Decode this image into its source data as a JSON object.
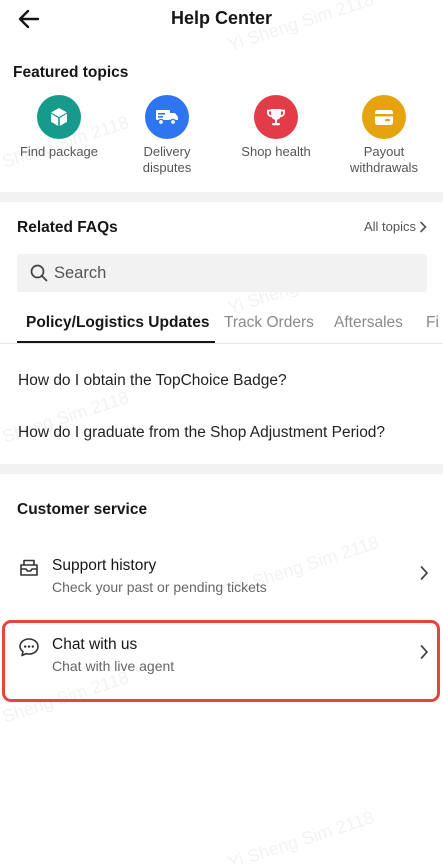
{
  "header": {
    "title": "Help Center",
    "back_icon": "arrow-left-icon"
  },
  "featured": {
    "title": "Featured topics",
    "items": [
      {
        "label": "Find package",
        "icon": "box-icon",
        "color": "#159a8b"
      },
      {
        "label": "Delivery\ndisputes",
        "icon": "truck-icon",
        "color": "#2f74f0"
      },
      {
        "label": "Shop health",
        "icon": "trophy-icon",
        "color": "#e13c48"
      },
      {
        "label": "Payout\nwithdrawals",
        "icon": "wallet-icon",
        "color": "#e5a40e"
      }
    ]
  },
  "faqs": {
    "title": "Related FAQs",
    "all_topics": "All topics",
    "search_placeholder": "Search",
    "tabs": [
      "Policy/Logistics Updates",
      "Track Orders",
      "Aftersales",
      "Fi"
    ],
    "active_tab": 0,
    "questions": [
      "How do I obtain the TopChoice Badge?",
      "How do I graduate from the Shop Adjustment Period?"
    ]
  },
  "service": {
    "title": "Customer service",
    "items": [
      {
        "title": "Support history",
        "subtitle": "Check your past or pending tickets",
        "icon": "ticket-icon"
      },
      {
        "title": "Chat with us",
        "subtitle": "Chat with live agent",
        "icon": "chat-bubble-icon"
      }
    ]
  },
  "watermark": "Yi Sheng Sim 2118",
  "colors": {
    "highlight": "#e8433f",
    "band": "#f2f2f2"
  }
}
